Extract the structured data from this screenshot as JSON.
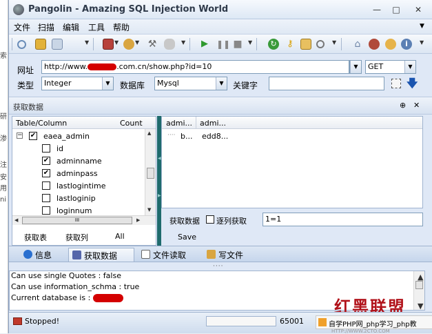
{
  "gutter": {
    "marks": [
      "索",
      "研",
      "渗",
      "注",
      "安",
      "用",
      "ni"
    ]
  },
  "window": {
    "title": "Pangolin - Amazing SQL Injection World",
    "controls": {
      "minimize": "—",
      "maximize": "□",
      "close": "✕"
    }
  },
  "menubar": {
    "items": [
      "文件",
      "扫描",
      "编辑",
      "工具",
      "帮助"
    ],
    "overflow": "▼"
  },
  "toolbar": {
    "icons": [
      "search-icon",
      "copy-icon",
      "export-icon",
      "table-icon",
      "tools-icon",
      "wrench-icon",
      "database-icon",
      "play-icon",
      "pause-icon",
      "stop-icon",
      "refresh-icon",
      "key-icon",
      "browse-icon",
      "find-icon",
      "home-icon",
      "bug-icon",
      "upload-icon",
      "info-icon"
    ],
    "arrow": "▼"
  },
  "form": {
    "url_label": "网址",
    "url_prefix": "http://www.",
    "url_suffix": ".com.cn/show.php?id=10",
    "method": "GET",
    "type_label": "类型",
    "type_value": "Integer",
    "db_label": "数据库",
    "db_value": "Mysql",
    "keyword_label": "关键字",
    "keyword_value": ""
  },
  "panel": {
    "title": "获取数据",
    "pin": "⊕",
    "close": "✕"
  },
  "tree": {
    "col_table": "Table/Column",
    "col_count": "Count",
    "root": {
      "label": "eaea_admin",
      "checked": true,
      "toggle": "−"
    },
    "columns": [
      {
        "label": "id",
        "checked": false
      },
      {
        "label": "adminname",
        "checked": true
      },
      {
        "label": "adminpass",
        "checked": true
      },
      {
        "label": "lastlogintime",
        "checked": false
      },
      {
        "label": "lastloginip",
        "checked": false
      },
      {
        "label": "loginnum",
        "checked": false
      }
    ],
    "hscroll_thumb": "III",
    "buttons": [
      "获取表",
      "获取列",
      "All"
    ]
  },
  "results": {
    "headers": [
      "admi...",
      "admi..."
    ],
    "rows": [
      [
        "b...",
        "edd8..."
      ]
    ],
    "fetch_label": "获取数据",
    "row_by_row_label": "逐列获取",
    "range_value": "1=1",
    "save_label": "Save"
  },
  "tabs": [
    {
      "label": "信息",
      "icon": "info-icon",
      "color": "#2a6fcf"
    },
    {
      "label": "获取数据",
      "icon": "database-icon",
      "color": "#5566aa",
      "active": true
    },
    {
      "label": "文件读取",
      "icon": "file-icon",
      "color": "#ffffff"
    },
    {
      "label": "写文件",
      "icon": "write-icon",
      "color": "#d9a540"
    }
  ],
  "log": {
    "lines": [
      "Can use single Quotes : false",
      "Can use information_schma : true",
      "Current database is :"
    ]
  },
  "statusbar": {
    "status": "Stopped!",
    "count": "65001",
    "overlay": "自学PHP网_php学习_php教",
    "watermark": "红黑联盟",
    "watermark_url": "HTTP://WWW.2CTO.COM"
  },
  "colors": {
    "accent": "#1f6b6d",
    "redaction": "#d40000",
    "chrome": "#dfe8f6"
  }
}
